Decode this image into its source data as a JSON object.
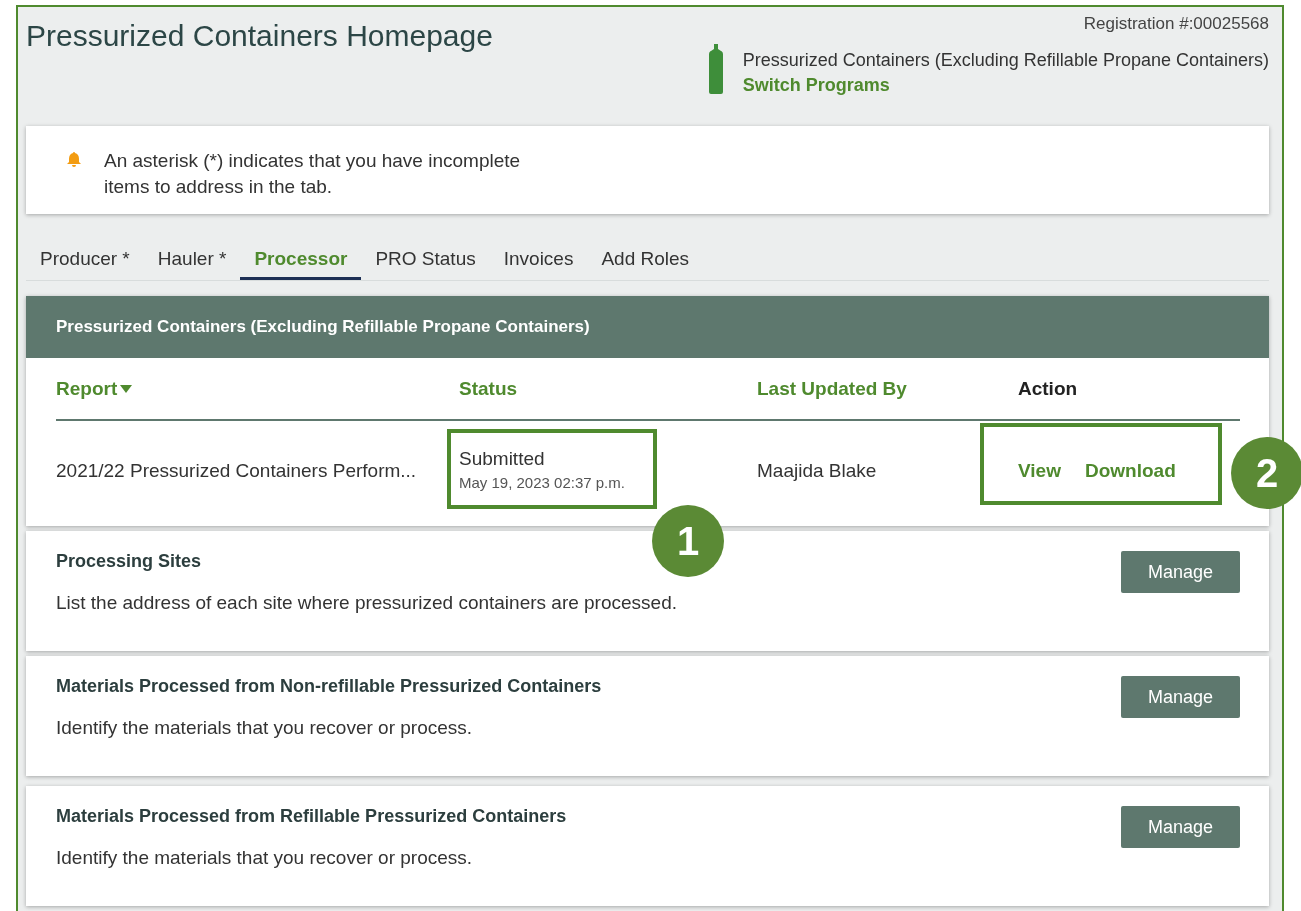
{
  "header": {
    "title": "Pressurized Containers Homepage",
    "registration": "Registration #:00025568",
    "program": "Pressurized Containers (Excluding Refillable Propane Containers)",
    "switch_link": "Switch Programs"
  },
  "notice": {
    "text": "An asterisk (*) indicates that you have incomplete items to address in the tab."
  },
  "tabs": [
    {
      "label": "Producer *",
      "selected": false
    },
    {
      "label": "Hauler *",
      "selected": false
    },
    {
      "label": "Processor",
      "selected": true
    },
    {
      "label": "PRO Status",
      "selected": false
    },
    {
      "label": "Invoices",
      "selected": false
    },
    {
      "label": "Add Roles",
      "selected": false
    }
  ],
  "panel": {
    "title": "Pressurized Containers (Excluding Refillable Propane Containers)",
    "columns": [
      {
        "label": "Report",
        "sortable": true,
        "sorted": true
      },
      {
        "label": "Status",
        "sortable": true,
        "sorted": false
      },
      {
        "label": "Last Updated By",
        "sortable": true,
        "sorted": false
      },
      {
        "label": "Action",
        "sortable": false,
        "sorted": false
      }
    ],
    "rows": [
      {
        "report": "2021/22 Pressurized Containers Perform...",
        "status": "Submitted",
        "status_time": "May 19, 2023 02:37 p.m.",
        "status_callout": "1",
        "updated_by": "Maajida Blake",
        "actions": [
          "View",
          "Download"
        ],
        "actions_callout": "2"
      }
    ]
  },
  "sections": [
    {
      "title": "Processing Sites",
      "description": "List the address of each site where pressurized containers are processed.",
      "button": "Manage"
    },
    {
      "title": "Materials Processed from Non-refillable Pressurized Containers",
      "description": "Identify the materials that you recover or process.",
      "button": "Manage"
    },
    {
      "title": "Materials Processed from Refillable Pressurized Containers",
      "description": "Identify the materials that you recover or process.",
      "button": "Manage"
    }
  ]
}
